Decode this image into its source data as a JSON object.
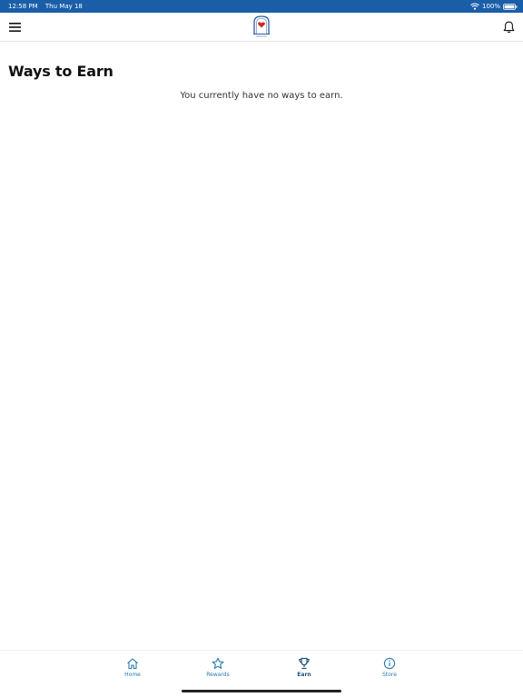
{
  "status_bar": {
    "time": "12:58 PM",
    "date": "Thu May 18",
    "battery": "100%"
  },
  "nav": {
    "menu_icon": "hamburger-menu-icon",
    "logo_icon": "heart-logo-icon",
    "bell_icon": "bell-icon"
  },
  "page": {
    "title": "Ways to Earn",
    "empty_message": "You currently have no ways to earn."
  },
  "tabs": [
    {
      "label": "Home",
      "icon": "home-icon",
      "active": false
    },
    {
      "label": "Rewards",
      "icon": "star-icon",
      "active": false
    },
    {
      "label": "Earn",
      "icon": "trophy-icon",
      "active": true
    },
    {
      "label": "Store",
      "icon": "info-icon",
      "active": false
    }
  ],
  "colors": {
    "status_bar": "#1a5ea8",
    "tab_inactive": "#2a7ab0",
    "tab_active": "#1d4f7a",
    "logo_red": "#d8232a",
    "logo_blue": "#2a5aa0"
  }
}
